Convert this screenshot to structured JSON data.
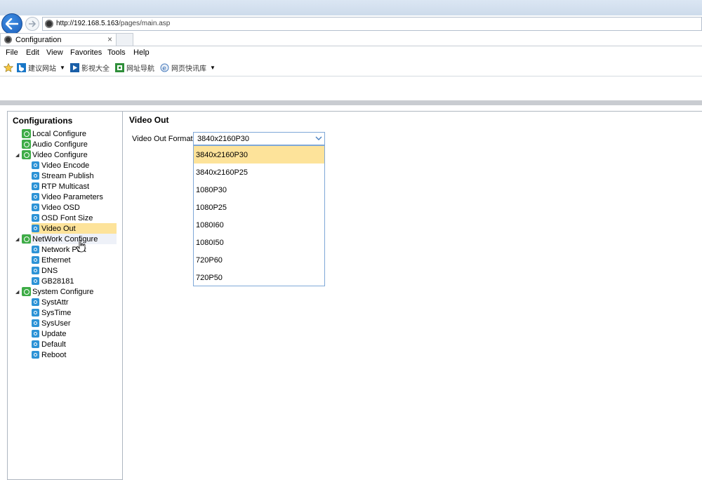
{
  "browser": {
    "url_host": "http://192.168.5.163",
    "url_path": "/pages/main.asp",
    "tab_title": "Configuration",
    "tab_close": "×",
    "menu": [
      "File",
      "Edit",
      "View",
      "Favorites",
      "Tools",
      "Help"
    ],
    "favorites": [
      {
        "label": "建议网站",
        "icon": "bing-icon",
        "has_caret": true
      },
      {
        "label": "影视大全",
        "icon": "video-icon",
        "has_caret": false
      },
      {
        "label": "网址导航",
        "icon": "nav-icon",
        "has_caret": false
      },
      {
        "label": "网页快讯库",
        "icon": "ie-icon",
        "has_caret": true
      }
    ]
  },
  "sidebar": {
    "title": "Configurations",
    "items": [
      {
        "label": "Local Configure",
        "level": 0,
        "icon": "gear-icon",
        "expandable": false
      },
      {
        "label": "Audio Configure",
        "level": 0,
        "icon": "gear-icon",
        "expandable": false
      },
      {
        "label": "Video Configure",
        "level": 0,
        "icon": "gear-icon",
        "expandable": true
      },
      {
        "label": "Video Encode",
        "level": 1,
        "icon": "node-icon"
      },
      {
        "label": "Stream Publish",
        "level": 1,
        "icon": "node-icon"
      },
      {
        "label": "RTP Multicast",
        "level": 1,
        "icon": "node-icon"
      },
      {
        "label": "Video Parameters",
        "level": 1,
        "icon": "node-icon"
      },
      {
        "label": "Video OSD",
        "level": 1,
        "icon": "node-icon"
      },
      {
        "label": "OSD Font Size",
        "level": 1,
        "icon": "node-icon"
      },
      {
        "label": "Video Out",
        "level": 1,
        "icon": "node-icon",
        "selected": true
      },
      {
        "label": "NetWork Configure",
        "level": 0,
        "icon": "gear-icon",
        "expandable": true,
        "hover": true
      },
      {
        "label": "Network Port",
        "level": 1,
        "icon": "node-icon"
      },
      {
        "label": "Ethernet",
        "level": 1,
        "icon": "node-icon"
      },
      {
        "label": "DNS",
        "level": 1,
        "icon": "node-icon"
      },
      {
        "label": "GB28181",
        "level": 1,
        "icon": "node-icon"
      },
      {
        "label": "System Configure",
        "level": 0,
        "icon": "gear-icon",
        "expandable": true
      },
      {
        "label": "SystAttr",
        "level": 1,
        "icon": "node-icon"
      },
      {
        "label": "SysTime",
        "level": 1,
        "icon": "node-icon"
      },
      {
        "label": "SysUser",
        "level": 1,
        "icon": "node-icon"
      },
      {
        "label": "Update",
        "level": 1,
        "icon": "node-icon"
      },
      {
        "label": "Default",
        "level": 1,
        "icon": "node-icon"
      },
      {
        "label": "Reboot",
        "level": 1,
        "icon": "node-icon"
      }
    ]
  },
  "content": {
    "title": "Video Out",
    "field_label": "Video Out Format",
    "selected_value": "3840x2160P30",
    "options": [
      "3840x2160P30",
      "3840x2160P25",
      "1080P30",
      "1080P25",
      "1080I60",
      "1080I50",
      "720P60",
      "720P50"
    ],
    "active_option": "3840x2160P30"
  },
  "colors": {
    "selection": "#fde39a",
    "tree_gear": "#3eac46",
    "tree_node": "#2d93d6",
    "select_border": "#7fa8d8"
  }
}
